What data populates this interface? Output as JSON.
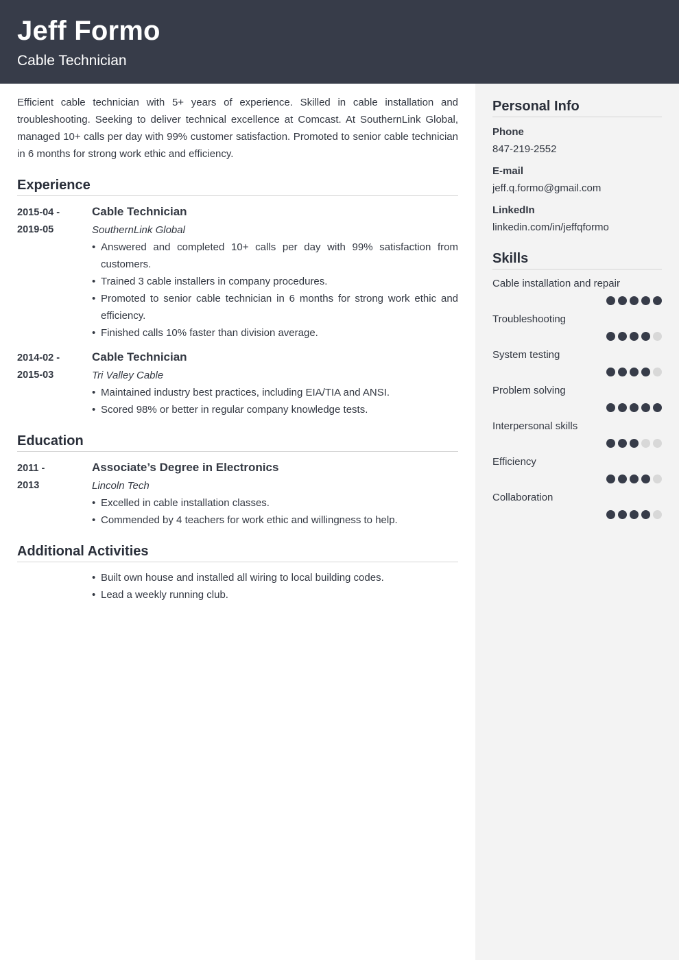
{
  "header": {
    "name": "Jeff Formo",
    "title": "Cable Technician"
  },
  "summary": "Efficient cable technician with 5+ years of experience. Skilled in cable installation and troubleshooting. Seeking to deliver technical excellence at Comcast. At SouthernLink Global, managed 10+ calls per day with 99% customer satisfaction. Promoted to senior cable technician in 6 months for strong work ethic and efficiency.",
  "experience": {
    "title": "Experience",
    "entries": [
      {
        "date_start": "2015-04 -",
        "date_end": "2019-05",
        "role": "Cable Technician",
        "org": "SouthernLink Global",
        "bullets": [
          "Answered and completed 10+ calls per day with 99% satisfaction from customers.",
          "Trained 3 cable installers in company procedures.",
          "Promoted to senior cable technician in 6 months for strong work ethic and efficiency.",
          "Finished calls 10% faster than division average."
        ]
      },
      {
        "date_start": "2014-02 -",
        "date_end": "2015-03",
        "role": "Cable Technician",
        "org": "Tri Valley Cable",
        "bullets": [
          "Maintained industry best practices, including EIA/TIA and ANSI.",
          "Scored 98% or better in regular company knowledge tests."
        ]
      }
    ]
  },
  "education": {
    "title": "Education",
    "entries": [
      {
        "date_start": "2011 -",
        "date_end": "2013",
        "role": "Associate’s Degree in Electronics",
        "org": "Lincoln Tech",
        "bullets": [
          "Excelled in cable installation classes.",
          "Commended by 4 teachers for work ethic and willingness to help."
        ]
      }
    ]
  },
  "activities": {
    "title": "Additional Activities",
    "bullets": [
      "Built own house and installed all wiring to local building codes.",
      "Lead a weekly running club."
    ]
  },
  "personal_info": {
    "title": "Personal Info",
    "items": [
      {
        "label": "Phone",
        "value": "847-219-2552"
      },
      {
        "label": "E-mail",
        "value": "jeff.q.formo@gmail.com"
      },
      {
        "label": "LinkedIn",
        "value": "linkedin.com/in/jeffqformo"
      }
    ]
  },
  "skills": {
    "title": "Skills",
    "max_level": 5,
    "items": [
      {
        "name": "Cable installation and repair",
        "level": 5
      },
      {
        "name": "Troubleshooting",
        "level": 4
      },
      {
        "name": "System testing",
        "level": 4
      },
      {
        "name": "Problem solving",
        "level": 5
      },
      {
        "name": "Interpersonal skills",
        "level": 3
      },
      {
        "name": "Efficiency",
        "level": 4
      },
      {
        "name": "Collaboration",
        "level": 4
      }
    ]
  },
  "colors": {
    "header_bg": "#373c49",
    "sidebar_bg": "#f3f3f3",
    "dot_filled": "#373c49",
    "dot_empty": "#d8d8d8"
  }
}
